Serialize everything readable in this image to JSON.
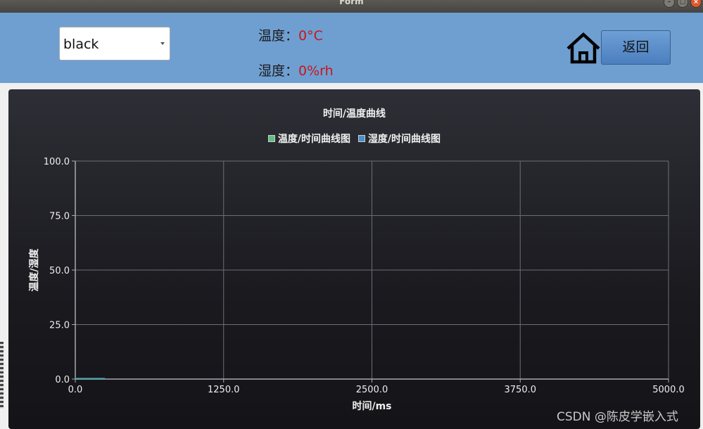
{
  "window": {
    "title": "Form",
    "buttons": [
      "–",
      "□",
      "×"
    ]
  },
  "header": {
    "color_select": {
      "value": "black"
    },
    "temperature": {
      "label": "温度：",
      "value": "0°C"
    },
    "humidity": {
      "label": "湿度：",
      "value": "0%rh"
    },
    "home_icon": "home-icon",
    "back_label": "返回",
    "bg_color": "#6f9fd1",
    "value_color": "#c8171a"
  },
  "chart_data": {
    "type": "line",
    "title": "时间/温度曲线",
    "xlabel": "时间/ms",
    "ylabel": "温度/湿度",
    "xlim": [
      0,
      5000
    ],
    "ylim": [
      0,
      100
    ],
    "x_ticks": [
      "0.0",
      "1250.0",
      "2500.0",
      "3750.0",
      "5000.0"
    ],
    "y_ticks": [
      "0.0",
      "25.0",
      "50.0",
      "75.0",
      "100.0"
    ],
    "grid": true,
    "legend_position": "top-center",
    "series": [
      {
        "name": "温度/时间曲线图",
        "color": "#5fbf7f",
        "x": [
          0,
          250
        ],
        "y": [
          0,
          0
        ]
      },
      {
        "name": "湿度/时间曲线图",
        "color": "#4a8fc8",
        "x": [
          0,
          250
        ],
        "y": [
          0,
          0
        ]
      }
    ]
  },
  "watermark": "CSDN @陈皮学嵌入式"
}
